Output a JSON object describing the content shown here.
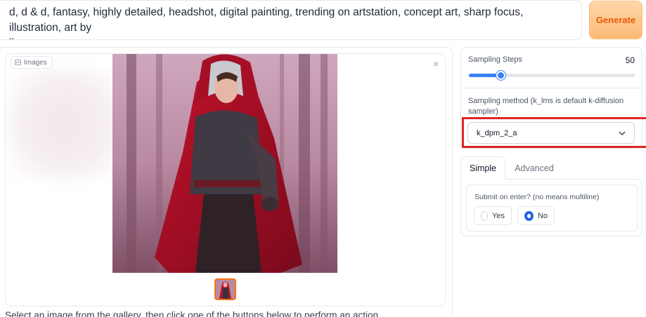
{
  "prompt": {
    "value": "d, d & d, fantasy, highly detailed, headshot, digital painting, trending on artstation, concept art, sharp focus, illustration, art by\nlleneuve"
  },
  "generate_button": {
    "label": "Generate"
  },
  "gallery": {
    "label": "Images",
    "close_symbol": "×",
    "caption": "Select an image from the gallery, then click one of the buttons below to perform an action."
  },
  "sampling_steps": {
    "label": "Sampling Steps",
    "value": "50",
    "fraction": 0.19
  },
  "sampling_method": {
    "label": "Sampling method (k_lms is default k-diffusion sampler)",
    "selected": "k_dpm_2_a"
  },
  "tabs": [
    {
      "label": "Simple",
      "active": true
    },
    {
      "label": "Advanced",
      "active": false
    }
  ],
  "submit_on_enter": {
    "label": "Submit on enter? (no means multiline)",
    "options": [
      {
        "label": "Yes",
        "checked": false
      },
      {
        "label": "No",
        "checked": true
      }
    ]
  },
  "colors": {
    "accent_orange": "#f97316",
    "slider_blue": "#3b82f6",
    "highlight_red": "#dc2626"
  },
  "icons": {
    "gallery_icon": "image-icon",
    "close_icon": "close-icon",
    "dropdown_icon": "chevron-down-icon"
  }
}
